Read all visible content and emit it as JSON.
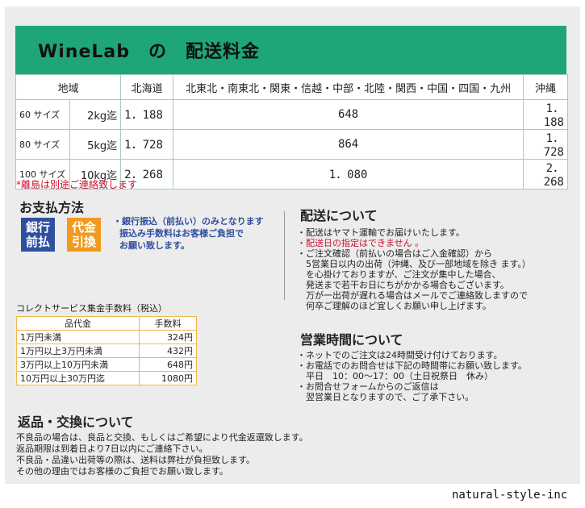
{
  "banner": {
    "title": "WineLab　の　配送料金"
  },
  "shipping_table": {
    "headers": [
      "地域",
      "北海道",
      "北東北・南東北・関東・信越・中部・北陸・関西・中国・四国・九州",
      "沖縄"
    ],
    "rows": [
      {
        "size": "60 サイズ",
        "weight": "2kg迄",
        "hokkaido": "1．188",
        "main": "648",
        "okinawa": "1．188"
      },
      {
        "size": "80 サイズ",
        "weight": "5kg迄",
        "hokkaido": "1．728",
        "main": "864",
        "okinawa": "1．728"
      },
      {
        "size": "100 サイズ",
        "weight": "10kg迄",
        "hokkaido": "2．268",
        "main": "1．080",
        "okinawa": "2．268"
      }
    ]
  },
  "remote_note": "*離島は別途ご連絡致します",
  "payment": {
    "heading": "お支払方法",
    "badge_bank": [
      "銀行",
      "前払"
    ],
    "badge_cod": [
      "代金",
      "引換"
    ],
    "notes": [
      "・銀行振込（前払い）のみとなります",
      "振込み手数料はお客様ご負担で",
      "お願い致します。"
    ]
  },
  "fee_table": {
    "title": "コレクトサービス集金手数料（税込）",
    "headers": [
      "品代金",
      "手数料"
    ],
    "rows": [
      {
        "range": "1万円未満",
        "fee": "324円"
      },
      {
        "range": "1万円以上3万円未満",
        "fee": "432円"
      },
      {
        "range": "3万円以上10万円未満",
        "fee": "648円"
      },
      {
        "range": "10万円以上30万円迄",
        "fee": "1080円"
      }
    ]
  },
  "delivery": {
    "heading": "配送について",
    "line1": "・配送はヤマト運輸でお届けいたします。",
    "line2_red": "・配送日の指定はできません 。",
    "line3": "・ご注文確認（前払いの場合はご入金確認）から\n　5営業日以内の出荷（沖縄、及び一部地域を除き ます。）\n　を心掛けておりますが、ご注文が集中した場合、\n　発送まで若干お日にちがかかる場合もございます。\n　万が一出荷が遅れる場合はメールでご連絡致しますので\n　何卒ご理解のほど宜しくお願い申し上げます。"
  },
  "hours": {
    "heading": "営業時間について",
    "text": "・ネットでのご注文は24時間受け付けております。\n・お電話でのお問合せは下記の時間帯にお願い致します。\n　平日　10：00～17：00（土日祝祭日　休み）\n・お問合せフォームからのご返信は\n　翌営業日となりますので、ご了承下さい。"
  },
  "returns": {
    "heading": "返品・交換について",
    "lines": [
      "不良品の場合は、良品と交換、もしくはご希望により代金返還致します。",
      "返品期限は到着日より7日以内にご連絡下さい。",
      "不良品・品違い出荷等の際は、送料は弊社が負担致します。",
      "その他の理由ではお客様のご負担でお願い致します。"
    ]
  },
  "footer": {
    "brand": "natural-style-inc"
  },
  "colors": {
    "banner": "#1fa57a",
    "blue": "#2f4fa0",
    "orange": "#f29a1f",
    "red": "#c8102e"
  }
}
